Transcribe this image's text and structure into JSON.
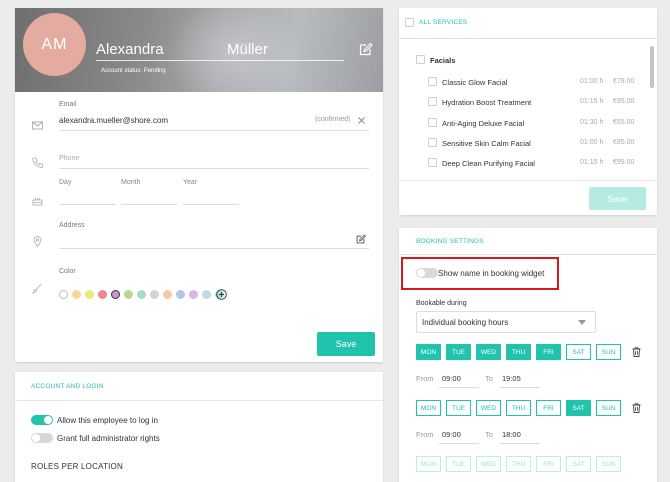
{
  "profile": {
    "initials": "AM",
    "first_name": "Alexandra",
    "last_name": "Müller",
    "account_status": "Account status: Pending",
    "email_label": "Email",
    "email_value": "alexandra.mueller@shore.com",
    "email_status": "(confirmed)",
    "phone_placeholder": "Phone",
    "day_label": "Day",
    "month_label": "Month",
    "year_label": "Year",
    "address_label": "Address",
    "color_label": "Color",
    "colors": [
      "#ffffff",
      "#f6d89a",
      "#eaea7a",
      "#e78a8a",
      "#c998c8",
      "#b9d990",
      "#a6dcc6",
      "#d4d4d4",
      "#f4c9a4",
      "#b2c7e6",
      "#d5b8e3",
      "#b9dde2",
      "#a9e0dd"
    ],
    "selected_color_index": 4,
    "save_label": "Save"
  },
  "account": {
    "title": "ACCOUNT AND LOGIN",
    "allow_login_label": "Allow this employee to log in",
    "allow_login_on": true,
    "admin_rights_label": "Grant full administrator rights",
    "admin_rights_on": false,
    "roles_title": "ROLES PER LOCATION"
  },
  "services": {
    "all_label": "ALL SERVICES",
    "category": "Facials",
    "items": [
      {
        "name": "Classic Glow Facial",
        "duration": "01:00 h",
        "price": "€79.00"
      },
      {
        "name": "Hydration Boost Treatment",
        "duration": "01:15 h",
        "price": "€95.00"
      },
      {
        "name": "Anti-Aging Deluxe Facial",
        "duration": "01:30 h",
        "price": "€65.00"
      },
      {
        "name": "Sensitive Skin Calm Facial",
        "duration": "01:00 h",
        "price": "€85.00"
      },
      {
        "name": "Deep Clean Purifying Facial",
        "duration": "01:15 h",
        "price": "€99.00"
      }
    ],
    "save_label": "Save"
  },
  "booking": {
    "title": "BOOKING SETTINGS",
    "show_name_label": "Show name in booking widget",
    "show_name_on": false,
    "bookable_label": "Bookable during",
    "bookable_value": "Individual booking hours",
    "days": [
      "MON",
      "TUE",
      "WED",
      "THU",
      "FRI",
      "SAT",
      "SUN"
    ],
    "from_label": "From",
    "to_label": "To",
    "schedules": [
      {
        "active_days": [
          true,
          true,
          true,
          true,
          true,
          false,
          false
        ],
        "from": "09:00",
        "to": "19:05"
      },
      {
        "active_days": [
          false,
          false,
          false,
          false,
          false,
          true,
          false
        ],
        "from": "09:00",
        "to": "18:00"
      }
    ]
  },
  "colors": {
    "accent": "#22c3ad",
    "highlight": "#d8191c"
  }
}
